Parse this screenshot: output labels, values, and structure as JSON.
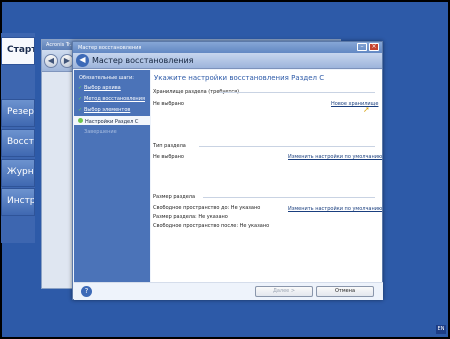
{
  "bg_app": {
    "title": "Acronis Tr...",
    "back_icon": "back-arrow-icon",
    "forward_icon": "forward-arrow-icon",
    "sidebar_items": [
      "Старто",
      "Резер",
      "Восстo",
      "Журна",
      "Инстру"
    ]
  },
  "dialog": {
    "titlebar": "Мастер восстановления",
    "header_title": "Мастер восстановления",
    "steps_heading": "Обязательные шаги:",
    "steps": [
      {
        "label": "Выбор архива",
        "state": "done"
      },
      {
        "label": "Метод восстановления",
        "state": "done"
      },
      {
        "label": "Выбор элементов",
        "state": "done"
      },
      {
        "label": "Настройки Раздел C",
        "state": "current"
      },
      {
        "label": "Завершение",
        "state": "disabled"
      }
    ],
    "main_title": "Укажите настройки восстановления Раздел C",
    "storage": {
      "heading": "Хранилище раздела (требуется)",
      "value": "Не выбрано",
      "link": "Новое хранилище"
    },
    "partition_type": {
      "heading": "Тип раздела",
      "value": "Не выбрано",
      "link": "Изменить настройки по умолчанию"
    },
    "partition_size": {
      "heading": "Размер раздела",
      "free_before": "Свободное пространство до: Не указано",
      "size": "Размер раздела: Не указано",
      "free_after": "Свободное пространство после: Не указано",
      "link": "Изменить настройки по умолчанию"
    },
    "buttons": {
      "next": "Далее >",
      "cancel": "Отмена"
    }
  },
  "taskbar": {
    "lang": "EN"
  }
}
